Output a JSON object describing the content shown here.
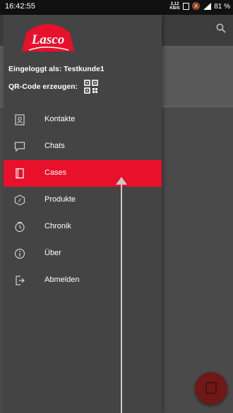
{
  "status_bar": {
    "time": "16:42:55",
    "net_speed_value": "2,12",
    "net_speed_unit": "KB/S",
    "battery": "81 %"
  },
  "drawer": {
    "logged_in_text": "Eingeloggt als: Testkunde1",
    "qr_label": "QR-Code erzeugen:",
    "menu": [
      {
        "label": "Kontakte",
        "icon": "contacts-icon"
      },
      {
        "label": "Chats",
        "icon": "chat-icon"
      },
      {
        "label": "Cases",
        "icon": "cases-icon"
      },
      {
        "label": "Produkte",
        "icon": "products-icon"
      },
      {
        "label": "Chronik",
        "icon": "history-icon"
      },
      {
        "label": "Über",
        "icon": "info-icon"
      },
      {
        "label": "Abmelden",
        "icon": "logout-icon"
      }
    ],
    "active_index": 2
  },
  "colors": {
    "brand_red": "#e8102a",
    "drawer_bg": "#444444",
    "fab": "#6f1818"
  }
}
